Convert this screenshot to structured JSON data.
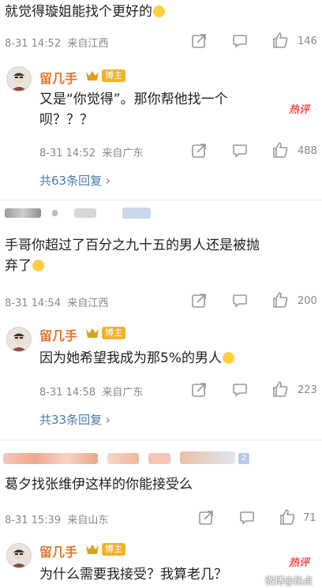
{
  "c1": {
    "text": "就觉得璇姐能找个更好的",
    "time": "8-31 14:52",
    "origin": "来自江西",
    "likes": "146"
  },
  "r1": {
    "username": "留几手",
    "badge": "博主",
    "hot": "热评",
    "text_line1": "又是“你觉得”。那你帮他找一个",
    "text_line2": "呗？？？",
    "time": "8-31 14:52",
    "origin": "来自广东",
    "likes": "488",
    "more_replies": "共63条回复 ›"
  },
  "c2": {
    "text_line1": "手哥你超过了百分之九十五的男人还是被抛",
    "text_line2": "弃了",
    "time": "8-31 14:54",
    "origin": "来自江西",
    "likes": "200"
  },
  "r2": {
    "username": "留几手",
    "badge": "博主",
    "text": "因为她希望我成为那5%的男人",
    "time": "8-31 14:58",
    "origin": "来自广东",
    "likes": "223",
    "more_replies": "共33条回复 ›"
  },
  "c3": {
    "level": "2",
    "text": "葛夕找张维伊这样的你能接受么",
    "time": "8-31 15:39",
    "origin": "来自山东",
    "likes": "71"
  },
  "r3": {
    "username": "留几手",
    "badge": "博主",
    "hot": "热评",
    "text": "为什么需要我接受？我算老几？"
  },
  "watermark": "微博@热点",
  "colors": {
    "username": "#e2762b",
    "link": "#4a78b2",
    "hot": "#f2524d",
    "badge": "#f3b12b"
  }
}
